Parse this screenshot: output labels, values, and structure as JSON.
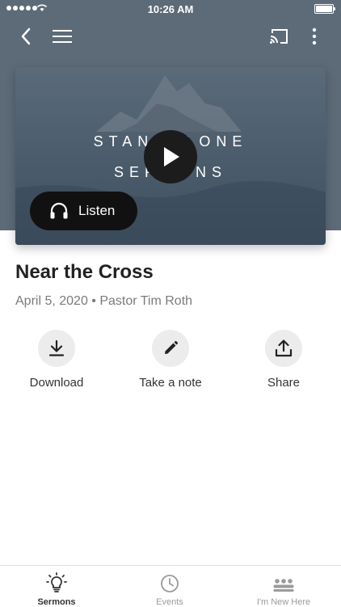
{
  "status_bar": {
    "time": "10:26 AM"
  },
  "nav": {
    "back_icon": "chevron-left-icon",
    "menu_icon": "hamburger-menu-icon",
    "cast_icon": "cast-icon",
    "more_icon": "more-vertical-icon"
  },
  "hero": {
    "title_line1": "STANDALONE",
    "title_line2": "SERMONS",
    "play_icon": "play-icon",
    "listen_label": "Listen"
  },
  "sermon": {
    "title": "Near the Cross",
    "meta": "April 5, 2020 • Pastor Tim Roth"
  },
  "actions": [
    {
      "label": "Download",
      "icon": "download-icon"
    },
    {
      "label": "Take a note",
      "icon": "pencil-icon"
    },
    {
      "label": "Share",
      "icon": "share-icon"
    }
  ],
  "tabs": [
    {
      "label": "Sermons",
      "icon": "lightbulb-icon",
      "active": true
    },
    {
      "label": "Events",
      "icon": "clock-icon",
      "active": false
    },
    {
      "label": "I'm New Here",
      "icon": "group-icon",
      "active": false
    }
  ],
  "colors": {
    "header": "#5d6b78",
    "dark_button": "#111111",
    "action_circle": "#ececec"
  }
}
